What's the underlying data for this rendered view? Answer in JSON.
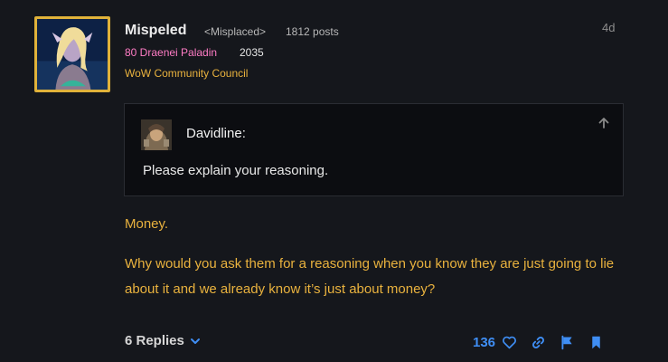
{
  "post": {
    "username": "Mispeled",
    "user_title": "<Misplaced>",
    "post_count": "1812 posts",
    "character": "80 Draenei Paladin",
    "character_points": "2035",
    "group": "WoW Community Council",
    "time_ago": "4d",
    "quote": {
      "username": "Davidline:",
      "text": "Please explain your reasoning."
    },
    "paragraphs": [
      "Money.",
      "Why would you ask them for a reasoning when you know they are just going to lie about it and we already know it’s just about money?"
    ],
    "replies_label": "6 Replies",
    "like_count": "136"
  },
  "colors": {
    "background": "#15171c",
    "accent_gold": "#e9b23e",
    "paladin_pink": "#ff7cc5",
    "action_blue": "#3f8ef4"
  },
  "icons": {
    "quote_jump": "arrow-up-icon",
    "replies": "chevron-down-icon",
    "like": "heart-icon",
    "link": "link-icon",
    "flag": "flag-icon",
    "bookmark": "bookmark-icon"
  }
}
